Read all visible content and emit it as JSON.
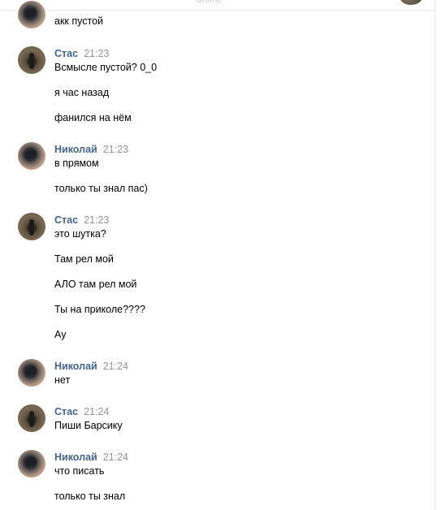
{
  "header": {
    "status": "online"
  },
  "messages": [
    {
      "author": "",
      "time": "",
      "avatar": "nikolay-avatar",
      "lines": [
        "акк пустой"
      ]
    },
    {
      "author": "Стас",
      "time": "21:23",
      "avatar": "stas-avatar",
      "lines": [
        "Всмысле пустой? 0_0",
        "я час назад",
        "фанился на нём"
      ]
    },
    {
      "author": "Николай",
      "time": "21:23",
      "avatar": "nikolay-avatar",
      "lines": [
        "в прямом",
        "только ты знал пас)"
      ]
    },
    {
      "author": "Стас",
      "time": "21:23",
      "avatar": "stas-avatar",
      "lines": [
        "это шутка?",
        "Там рел мой",
        "АЛО там рел мой",
        "Ты на приколе????",
        "Ау"
      ]
    },
    {
      "author": "Николай",
      "time": "21:24",
      "avatar": "nikolay-avatar",
      "lines": [
        "нет"
      ]
    },
    {
      "author": "Стас",
      "time": "21:24",
      "avatar": "stas-avatar",
      "lines": [
        "Пиши Барсику"
      ]
    },
    {
      "author": "Николай",
      "time": "21:24",
      "avatar": "nikolay-avatar",
      "lines": [
        "что писать",
        "только ты знал"
      ]
    }
  ],
  "colors": {
    "author": "#42648b",
    "time": "#939393",
    "text": "#000000",
    "divider": "#e7e8ec"
  }
}
